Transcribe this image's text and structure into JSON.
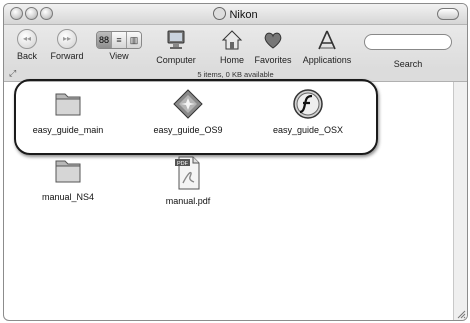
{
  "window": {
    "title": "Nikon"
  },
  "toolbar": {
    "back_label": "Back",
    "forward_label": "Forward",
    "view_label": "View",
    "view_modes": [
      "88",
      "≡",
      "▥"
    ],
    "computer_label": "Computer",
    "home_label": "Home",
    "favorites_label": "Favorites",
    "applications_label": "Applications",
    "search_label": "Search"
  },
  "status": {
    "text": "5 items, 0 KB available"
  },
  "files": [
    {
      "name": "easy_guide_main",
      "icon": "folder-icon"
    },
    {
      "name": "easy_guide_OS9",
      "icon": "os9-installer-icon"
    },
    {
      "name": "easy_guide_OSX",
      "icon": "flash-app-icon"
    },
    {
      "name": "manual_NS4",
      "icon": "folder-icon"
    },
    {
      "name": "manual.pdf",
      "icon": "pdf-document-icon",
      "badge": "PDF"
    }
  ]
}
